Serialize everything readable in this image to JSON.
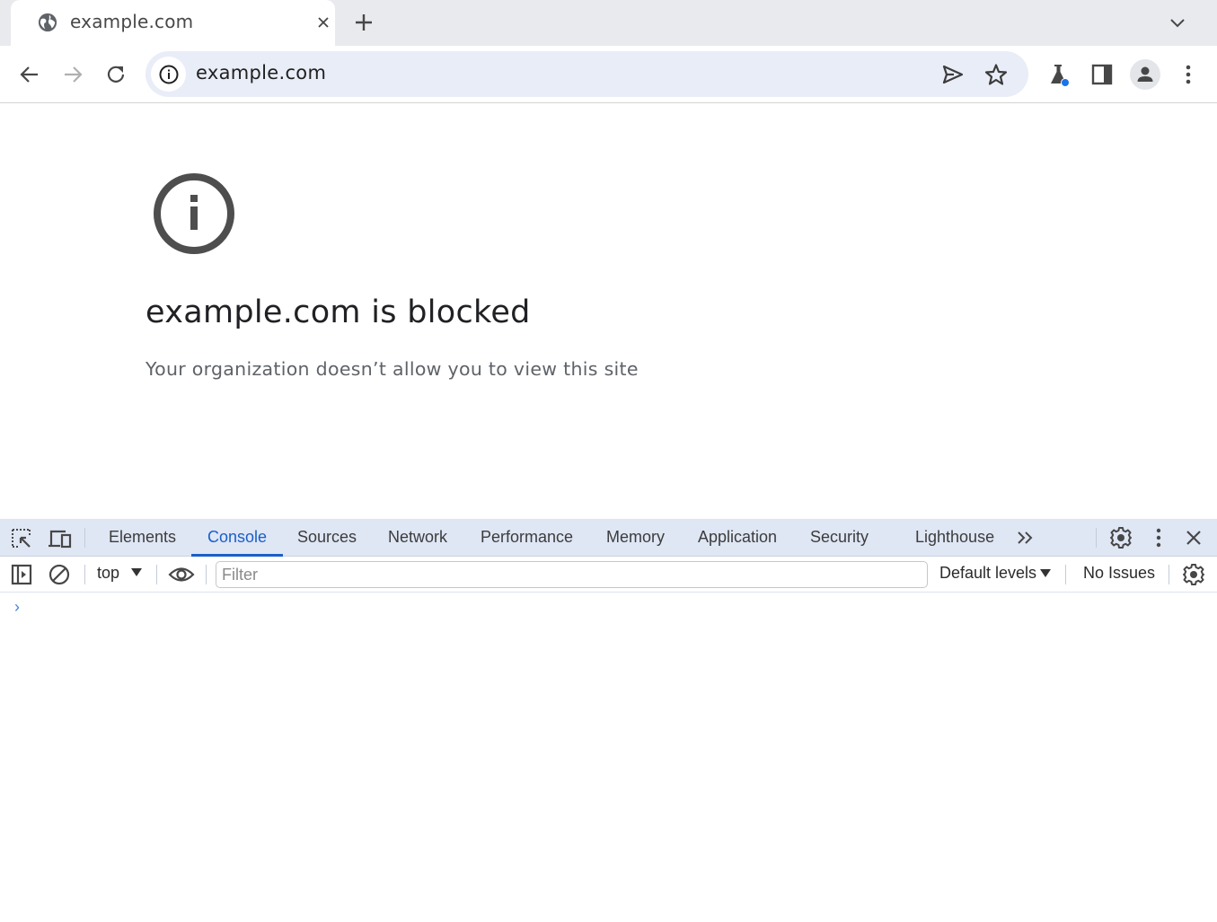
{
  "browser": {
    "tab": {
      "title": "example.com",
      "favicon": "globe-icon",
      "close_icon": "close-icon"
    },
    "new_tab_icon": "plus-icon",
    "tab_search_icon": "chevron-down-icon",
    "toolbar": {
      "back_icon": "arrow-left-icon",
      "forward_icon": "arrow-right-icon",
      "reload_icon": "reload-icon",
      "site_info_icon": "info-icon",
      "url": "example.com",
      "send_icon": "send-icon",
      "bookmark_icon": "star-icon",
      "labs_icon": "flask-icon",
      "side_panel_icon": "side-panel-icon",
      "profile_icon": "person-icon",
      "menu_icon": "kebab-menu-icon"
    }
  },
  "page": {
    "icon": "info-circle-icon",
    "title": "example.com is blocked",
    "subtitle": "Your organization doesn’t allow you to view this site"
  },
  "devtools": {
    "tabs": [
      {
        "label": "Elements",
        "active": false
      },
      {
        "label": "Console",
        "active": true
      },
      {
        "label": "Sources",
        "active": false
      },
      {
        "label": "Network",
        "active": false
      },
      {
        "label": "Performance",
        "active": false
      },
      {
        "label": "Memory",
        "active": false
      },
      {
        "label": "Application",
        "active": false
      },
      {
        "label": "Security",
        "active": false
      },
      {
        "label": "Lighthouse",
        "active": false
      }
    ],
    "more_tabs_icon": "double-chevron-right-icon",
    "settings_icon": "gear-icon",
    "menu_icon": "kebab-menu-icon",
    "close_icon": "close-icon",
    "console": {
      "sidebar_toggle_icon": "sidebar-toggle-icon",
      "clear_icon": "clear-console-icon",
      "context": "top",
      "live_expression_icon": "eye-icon",
      "filter_placeholder": "Filter",
      "filter_value": "",
      "levels": "Default levels",
      "issues": "No Issues",
      "settings_icon": "gear-icon",
      "prompt": "›"
    },
    "colors": {
      "accent": "#1a5fc9",
      "tabbar_bg": "#dfe6f4"
    }
  }
}
